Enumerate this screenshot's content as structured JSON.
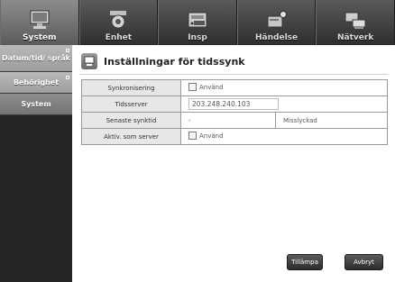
{
  "tabs": [
    {
      "label": "System",
      "icon": "system-monitor-icon",
      "active": true
    },
    {
      "label": "Enhet",
      "icon": "camera-icon",
      "active": false
    },
    {
      "label": "Insp",
      "icon": "recorder-icon",
      "active": false
    },
    {
      "label": "Händelse",
      "icon": "event-icon",
      "active": false
    },
    {
      "label": "Nätverk",
      "icon": "network-icon",
      "active": false
    }
  ],
  "sidebar": {
    "items": [
      {
        "label": "Datum/tid/ språk"
      },
      {
        "label": "Behörighet"
      },
      {
        "label": "System"
      }
    ]
  },
  "page": {
    "title": "Inställningar för tidssynk",
    "icon": "time-sync-icon"
  },
  "settings": {
    "rows": [
      {
        "label": "Synkronisering",
        "value": "Använd"
      },
      {
        "label": "Tidsserver",
        "value": "203.248.240.103"
      },
      {
        "label": "Senaste synktid",
        "value": "-",
        "status": "Misslyckad"
      },
      {
        "label": "Aktiv. som server",
        "value": "Använd"
      }
    ]
  },
  "buttons": {
    "apply": "Tillämpa",
    "cancel": "Avbryt"
  },
  "colors": {
    "topbar": "#3a3a3a",
    "sidebar": "#252525",
    "sidebar_item": "#a9a9a9"
  }
}
